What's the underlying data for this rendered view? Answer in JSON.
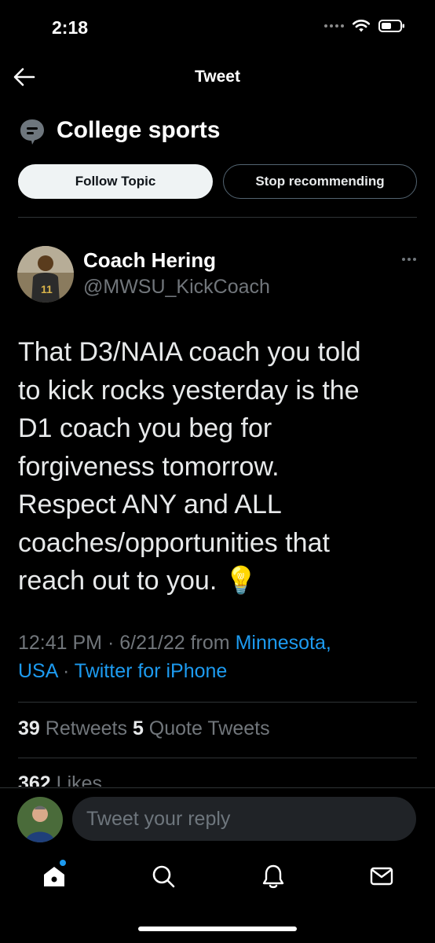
{
  "status_bar": {
    "time": "2:18"
  },
  "header": {
    "title": "Tweet",
    "back_icon": "arrow-left-icon"
  },
  "topic": {
    "name": "College sports",
    "follow_label": "Follow Topic",
    "stop_label": "Stop recommending"
  },
  "tweet": {
    "author_name": "Coach Hering",
    "author_handle": "@MWSU_KickCoach",
    "text": "That D3/NAIA coach you told\nto kick rocks yesterday is the\nD1 coach you beg for\nforgiveness tomorrow.\nRespect ANY and ALL\ncoaches/opportunities that\nreach out to you. 💡",
    "time": "12:41 PM",
    "date": "6/21/22",
    "from_label": "from",
    "location": "Minnesota,\nUSA",
    "source": "Twitter for iPhone",
    "retweets_count": "39",
    "retweets_label": "Retweets",
    "quotes_count": "5",
    "quotes_label": "Quote Tweets",
    "likes_count": "362",
    "likes_label": "Likes"
  },
  "reply": {
    "placeholder": "Tweet your reply"
  },
  "colors": {
    "accent": "#1d9bf0",
    "background": "#000000",
    "secondary_text": "#71767b"
  }
}
